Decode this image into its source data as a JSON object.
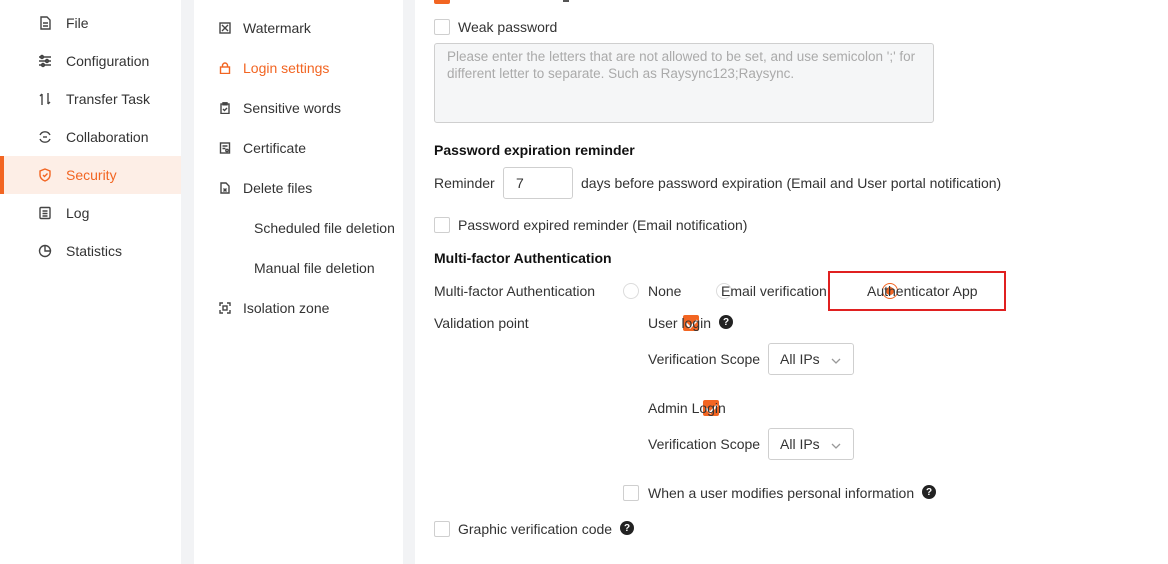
{
  "nav": {
    "items": [
      {
        "label": "File",
        "icon": "file-icon",
        "active": false
      },
      {
        "label": "Configuration",
        "icon": "sliders-icon",
        "active": false
      },
      {
        "label": "Transfer Task",
        "icon": "transfer-icon",
        "active": false
      },
      {
        "label": "Collaboration",
        "icon": "collaboration-icon",
        "active": false
      },
      {
        "label": "Security",
        "icon": "shield-icon",
        "active": true
      },
      {
        "label": "Log",
        "icon": "log-icon",
        "active": false
      },
      {
        "label": "Statistics",
        "icon": "pie-chart-icon",
        "active": false
      }
    ]
  },
  "submenu": {
    "items": [
      {
        "label": "Watermark",
        "icon": "watermark-icon"
      },
      {
        "label": "Login settings",
        "icon": "lock-icon",
        "active": true
      },
      {
        "label": "Sensitive words",
        "icon": "clipboard-icon"
      },
      {
        "label": "Certificate",
        "icon": "certificate-icon"
      },
      {
        "label": "Delete files",
        "icon": "delete-file-icon"
      },
      {
        "label": "Scheduled file deletion"
      },
      {
        "label": "Manual file deletion"
      },
      {
        "label": "Isolation zone",
        "icon": "isolation-icon"
      }
    ]
  },
  "main": {
    "weak_password_label": "Weak password",
    "weak_password_placeholder": "Please enter the letters that are not allowed to be set, and use semicolon ';' for different letter to separate. Such as Raysync123;Raysync.",
    "expiration_heading": "Password expiration reminder",
    "reminder_label": "Reminder",
    "reminder_days": "7",
    "reminder_suffix": "days before password expiration (Email and User portal notification)",
    "expired_reminder_label": "Password expired reminder (Email notification)",
    "mfa_heading": "Multi-factor Authentication",
    "mfa_label": "Multi-factor Authentication",
    "mfa_options": [
      "None",
      "Email verification",
      "Authenticator App"
    ],
    "mfa_selected": "Authenticator App",
    "validation_label": "Validation point",
    "user_login_label": "User login",
    "user_login_checked": true,
    "verification_scope_label": "Verification Scope",
    "user_scope_value": "All IPs",
    "admin_login_label": "Admin Login",
    "admin_login_checked": true,
    "admin_scope_value": "All IPs",
    "modify_info_label": "When a user modifies personal information",
    "modify_info_checked": false,
    "graphic_code_label": "Graphic verification code",
    "graphic_code_checked": false,
    "accent_color": "#f26522",
    "highlight_color": "#e02020"
  }
}
